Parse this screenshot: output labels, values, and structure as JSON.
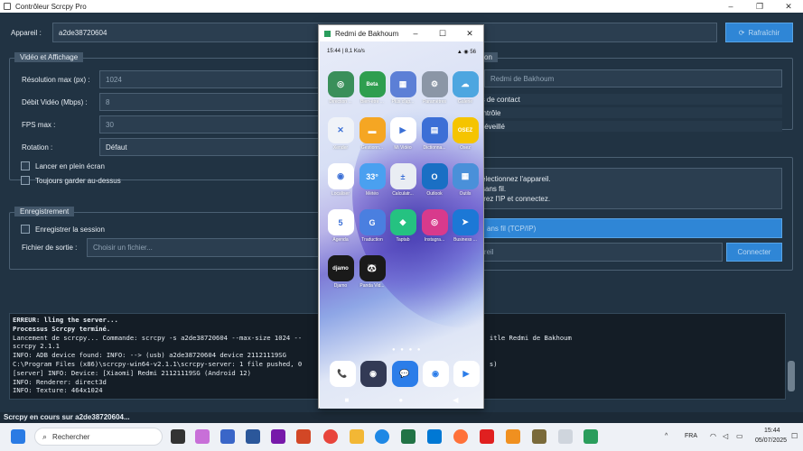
{
  "window": {
    "title": "Contrôleur Scrcpy Pro",
    "controls": [
      "–",
      "❐",
      "✕"
    ]
  },
  "device_row": {
    "label": "Appareil :",
    "value": "a2de38720604",
    "refresh_label": "Rafraîchir"
  },
  "video": {
    "title": "Vidéo et Affichage",
    "max_res_label": "Résolution max (px) :",
    "max_res_value": "1024",
    "bitrate_label": "Débit Vidéo (Mbps) :",
    "bitrate_value": "8",
    "fps_label": "FPS max :",
    "fps_value": "30",
    "rotation_label": "Rotation :",
    "rotation_value": "Défaut",
    "fullscreen_label": "Lancer en plein écran",
    "ontop_label": "Toujours garder au-dessus"
  },
  "recording": {
    "title": "Enregistrement",
    "record_label": "Enregistrer la session",
    "output_label": "Fichier de sortie :",
    "output_placeholder": "Choisir un fichier..."
  },
  "right_panel": {
    "title_suffix": "on",
    "window_title_value": "Redmi de Bakhoum",
    "opt1": "nts de contact",
    "opt2": "contrôle",
    "opt3": "eil éveillé",
    "help1": "électionnez l'appareil.",
    "help2": "sans fil.",
    "help3": "trez l'IP et connectez.",
    "wireless_btn": "ans fil (TCP/IP)",
    "ip_placeholder": "pareil",
    "connect_btn": "Connecter"
  },
  "console": {
    "lines": [
      {
        "text": "ERREUR: lling the server...",
        "bold": true
      },
      {
        "text": "Processus Scrcpy terminé.",
        "bold": true
      },
      {
        "text": "Lancement de scrcpy... Commande: scrcpy -s a2de38720604 --max-size 1024 --                                                itle Redmi de Bakhoum",
        "bold": false
      },
      {
        "text": "scrcpy 2.1.1",
        "bold": false
      },
      {
        "text": "INFO: ADB device found: INFO: --> (usb) a2de38720604 device 21121119SG",
        "bold": false
      },
      {
        "text": "C:\\Program Files (x86)\\scrcpy-win64-v2.1.1\\scrcpy-server: 1 file pushed, 0                                                s)",
        "bold": false
      },
      {
        "text": "[server] INFO: Device: [Xiaomi] Redmi 21121119SG (Android 12)",
        "bold": false
      },
      {
        "text": "INFO: Renderer: direct3d",
        "bold": false
      },
      {
        "text": "INFO: Texture: 464x1024",
        "bold": false
      }
    ]
  },
  "status_bar": {
    "text": "Scrcpy en cours sur a2de38720604..."
  },
  "phone": {
    "window_title": "Redmi de Bakhoum",
    "status_time": "15:44 | 8,1 Ko/s",
    "status_right": "▲ ◉ 56",
    "apps": [
      {
        "label": "Direction ...",
        "color": "#3a8f5a",
        "glyph": "◎"
      },
      {
        "label": "Bien-être ...",
        "color": "#2e9e4f",
        "glyph": "Beta"
      },
      {
        "label": "Plus d'ap...",
        "color": "#5c7fd6",
        "glyph": "▦"
      },
      {
        "label": "Paramètres",
        "color": "#8b96a6",
        "glyph": "⚙"
      },
      {
        "label": "Galerie",
        "color": "#4da6e0",
        "glyph": "☁"
      },
      {
        "label": "Xender",
        "color": "#f0f3f8",
        "glyph": "✕"
      },
      {
        "label": "Gestionn...",
        "color": "#f5a623",
        "glyph": "▬"
      },
      {
        "label": "Mi Vidéo",
        "color": "#ffffff",
        "glyph": "▶"
      },
      {
        "label": "Dictionna...",
        "color": "#3c6fd6",
        "glyph": "▤"
      },
      {
        "label": "Osez",
        "color": "#f5c400",
        "glyph": "OSEZ"
      },
      {
        "label": "Localiser",
        "color": "#ffffff",
        "glyph": "◉"
      },
      {
        "label": "Météo",
        "color": "#4aa0f0",
        "glyph": "33°"
      },
      {
        "label": "Calculatr...",
        "color": "#e9edf3",
        "glyph": "±"
      },
      {
        "label": "Outlook",
        "color": "#1a6fc4",
        "glyph": "O"
      },
      {
        "label": "Outils",
        "color": "#4a90d9",
        "glyph": "▦"
      },
      {
        "label": "Agenda",
        "color": "#ffffff",
        "glyph": "5"
      },
      {
        "label": "Traduction",
        "color": "#4a7fe0",
        "glyph": "G"
      },
      {
        "label": "Taptab",
        "color": "#25c281",
        "glyph": "◆"
      },
      {
        "label": "Instagra...",
        "color": "#d83a8c",
        "glyph": "◎"
      },
      {
        "label": "Business ...",
        "color": "#1c78d6",
        "glyph": "➤"
      },
      {
        "label": "Djamo",
        "color": "#1a1a1a",
        "glyph": "djamo"
      },
      {
        "label": "Panda Vid...",
        "color": "#1a1a1a",
        "glyph": "🐼"
      }
    ],
    "dock": [
      {
        "color": "#ffffff",
        "glyph": "📞"
      },
      {
        "color": "#333a55",
        "glyph": "◉"
      },
      {
        "color": "#2b7de9",
        "glyph": "💬"
      },
      {
        "color": "#ffffff",
        "glyph": "◉"
      },
      {
        "color": "#ffffff",
        "glyph": "▶"
      }
    ],
    "page_dots": "● ● ● ●",
    "nav": [
      "■",
      "●",
      "◀"
    ]
  },
  "taskbar": {
    "search_placeholder": "Rechercher",
    "lang": "FRA",
    "time": "15:44",
    "date": "05/07/2025"
  }
}
